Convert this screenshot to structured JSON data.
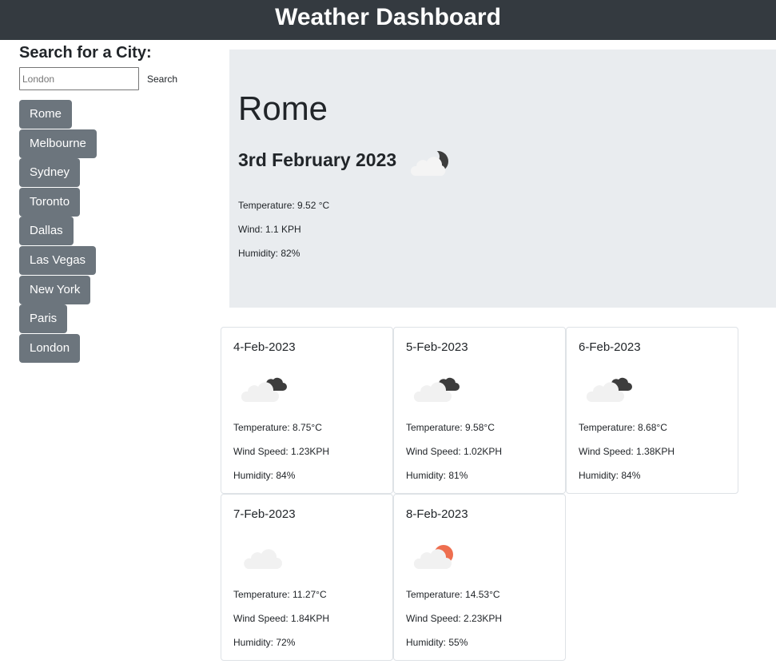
{
  "header": {
    "title": "Weather Dashboard"
  },
  "search": {
    "title": "Search for a City:",
    "placeholder": "London",
    "button_label": "Search",
    "history": [
      "Rome",
      "Melbourne",
      "Sydney",
      "Toronto",
      "Dallas",
      "Las Vegas",
      "New York",
      "Paris",
      "London"
    ]
  },
  "current": {
    "city": "Rome",
    "date": "3rd February 2023",
    "icon": "night-cloudy-icon",
    "temperature": "Temperature: 9.52 °C",
    "wind": "Wind: 1.1 KPH",
    "humidity": "Humidity: 82%"
  },
  "forecast": [
    {
      "date": "4-Feb-2023",
      "icon": "broken-clouds-icon",
      "temperature": "Temperature: 8.75°C",
      "wind": "Wind Speed: 1.23KPH",
      "humidity": "Humidity: 84%"
    },
    {
      "date": "5-Feb-2023",
      "icon": "broken-clouds-icon",
      "temperature": "Temperature: 9.58°C",
      "wind": "Wind Speed: 1.02KPH",
      "humidity": "Humidity: 81%"
    },
    {
      "date": "6-Feb-2023",
      "icon": "broken-clouds-icon",
      "temperature": "Temperature: 8.68°C",
      "wind": "Wind Speed: 1.38KPH",
      "humidity": "Humidity: 84%"
    },
    {
      "date": "7-Feb-2023",
      "icon": "cloud-icon",
      "temperature": "Temperature: 11.27°C",
      "wind": "Wind Speed: 1.84KPH",
      "humidity": "Humidity: 72%"
    },
    {
      "date": "8-Feb-2023",
      "icon": "partly-sunny-icon",
      "temperature": "Temperature: 14.53°C",
      "wind": "Wind Speed: 2.23KPH",
      "humidity": "Humidity: 55%"
    }
  ],
  "colors": {
    "header_bg": "#343a40",
    "button_bg": "#6c757d",
    "panel_bg": "#e9ecef",
    "sun": "#ee6e4f"
  }
}
